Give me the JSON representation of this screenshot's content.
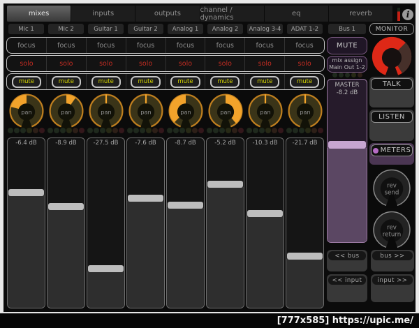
{
  "tabs": [
    {
      "label": "mixes",
      "selected": true
    },
    {
      "label": "inputs",
      "selected": false
    },
    {
      "label": "outputs",
      "selected": false
    },
    {
      "label": "channel / dynamics",
      "selected": false
    },
    {
      "label": "eq",
      "selected": false
    },
    {
      "label": "reverb",
      "selected": false
    }
  ],
  "info_icon_glyph": "i",
  "strip": {
    "focus_label": "focus",
    "solo_label": "solo",
    "mute_label": "mute",
    "pan_label": "pan"
  },
  "channels": [
    {
      "name": "Mic 1",
      "level_db": "-6.4 dB",
      "pan_angle": -75,
      "fader_pos": 30.2
    },
    {
      "name": "Mic 2",
      "level_db": "-8.9 dB",
      "pan_angle": 35,
      "fader_pos": 38.4
    },
    {
      "name": "Guitar 1",
      "level_db": "-27.5 dB",
      "pan_angle": 0,
      "fader_pos": 75.1
    },
    {
      "name": "Guitar 2",
      "level_db": "-7.6 dB",
      "pan_angle": 0,
      "fader_pos": 33.5
    },
    {
      "name": "Analog 1",
      "level_db": "-8.7 dB",
      "pan_angle": -135,
      "fader_pos": 37.6
    },
    {
      "name": "Analog 2",
      "level_db": "-5.2 dB",
      "pan_angle": 140,
      "fader_pos": 25.3
    },
    {
      "name": "Analog 3-4",
      "level_db": "-10.3 dB",
      "pan_angle": 0,
      "fader_pos": 42.4
    },
    {
      "name": "ADAT 1-2",
      "level_db": "-21.7 dB",
      "pan_angle": 0,
      "fader_pos": 67.3
    }
  ],
  "led_colors": [
    "#1f291d",
    "#1f291d",
    "#1f291d",
    "#272915",
    "#2d1f17",
    "#33171b"
  ],
  "bus": {
    "name": "Bus 1",
    "mute_label": "MUTE",
    "mix_assign": [
      "mix assign",
      "Main Out 1-2"
    ],
    "master_label": "MASTER",
    "master_db": "-8.2 dB",
    "fader_pos": 37.9
  },
  "monitor": {
    "name": "MONITOR",
    "talk_label": "TALK",
    "listen_label": "LISTEN",
    "meters_label": "METERS",
    "rev_send": [
      "rev",
      "send"
    ],
    "rev_return": [
      "rev",
      "return"
    ]
  },
  "nav": {
    "bus_prev": "<< bus",
    "bus_next": "bus >>",
    "input_prev": "<< input",
    "input_next": "input >>"
  },
  "watermark": "[777x585] https://upic.me/",
  "colors": {
    "pan_ring": "#bf7f1f",
    "pan_body": "#3a3418",
    "pan_wedge": "#f2a32b",
    "monitor_red": "#de2817",
    "monitor_dark_segment": "#46302a",
    "solo_red": "#c22c22",
    "mute_yellow": "#d6d600",
    "bus_purple_border": "#7d5c84",
    "bus_fill": "#5b4763",
    "meters_led": "#b56cc4"
  }
}
